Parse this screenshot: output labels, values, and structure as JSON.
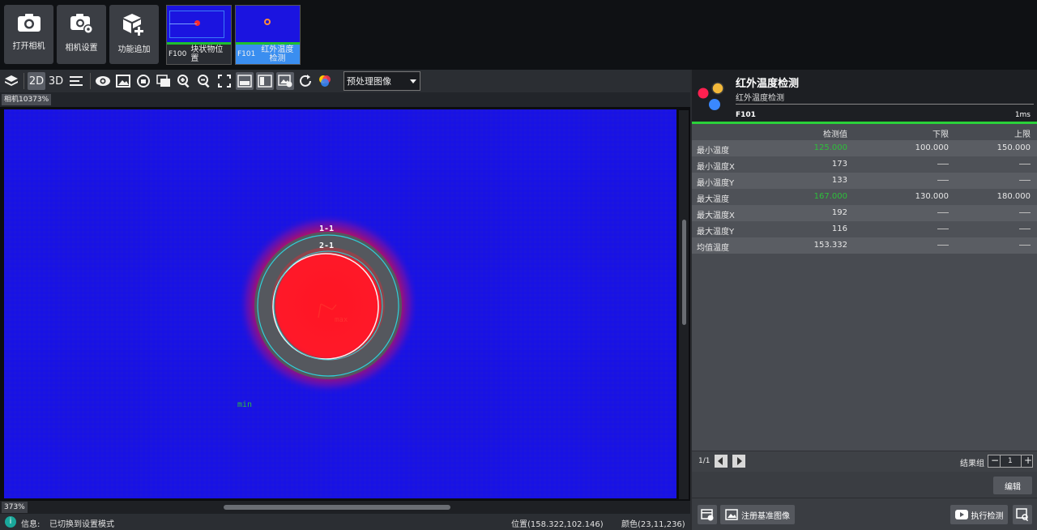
{
  "toolbar_top": {
    "buttons": [
      {
        "label": "打开相机",
        "icon": "camera-icon"
      },
      {
        "label": "相机设置",
        "icon": "camera-settings-icon"
      },
      {
        "label": "功能追加",
        "icon": "add-module-icon"
      }
    ],
    "thumbnails": [
      {
        "code": "F100",
        "label": "块状物位置"
      },
      {
        "code": "F101",
        "label": "红外温度检测"
      }
    ]
  },
  "view_toolbar": {
    "mode_2d": "2D",
    "mode_3d": "3D",
    "select_value": "预处理图像"
  },
  "view": {
    "tag": "相机10373%",
    "zoom": "373%",
    "overlay": {
      "label_outer": "1-1",
      "label_inner": "2-1",
      "max_label": "max",
      "min_label": "min"
    }
  },
  "status": {
    "info_label": "信息:",
    "message": "已切换到设置模式",
    "position": "位置(158.322,102.146)",
    "color": "颜色(23,11,236)"
  },
  "panel": {
    "title": "红外温度检测",
    "subtitle": "红外温度检测",
    "code": "F101",
    "time": "1ms",
    "headers": {
      "value": "检测值",
      "lower": "下限",
      "upper": "上限"
    },
    "rows": [
      {
        "name": "最小温度",
        "value": "125.000",
        "lower": "100.000",
        "upper": "150.000",
        "value_color": "green"
      },
      {
        "name": "最小温度X",
        "value": "173",
        "lower": "",
        "upper": ""
      },
      {
        "name": "最小温度Y",
        "value": "133",
        "lower": "",
        "upper": ""
      },
      {
        "name": "最大温度",
        "value": "167.000",
        "lower": "130.000",
        "upper": "180.000",
        "value_color": "green"
      },
      {
        "name": "最大温度X",
        "value": "192",
        "lower": "",
        "upper": ""
      },
      {
        "name": "最大温度Y",
        "value": "116",
        "lower": "",
        "upper": ""
      },
      {
        "name": "均值温度",
        "value": "153.332",
        "lower": "",
        "upper": ""
      }
    ],
    "page": "1/1",
    "result_group_label": "结果组",
    "result_group_value": "1",
    "edit_label": "编辑",
    "register_label": "注册基准图像",
    "run_label": "执行检测"
  },
  "colors": {
    "accent_green": "#2ad13a",
    "image_blue": "#1b14e0",
    "ring_red": "#ff1a2a"
  }
}
